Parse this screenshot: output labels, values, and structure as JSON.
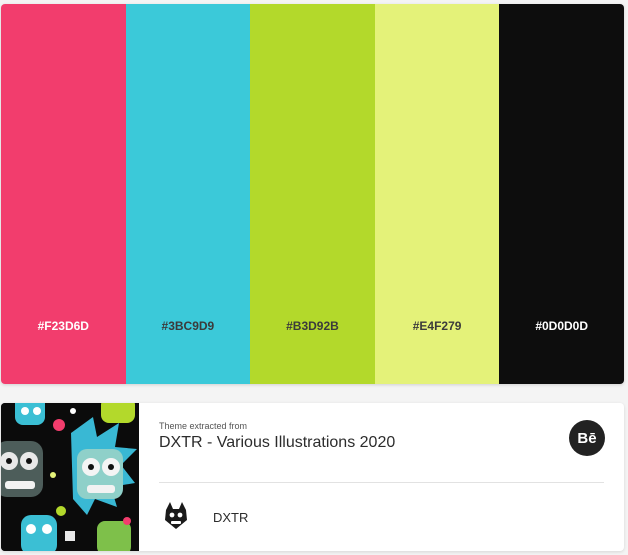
{
  "palette": {
    "swatches": [
      {
        "hex": "#F23D6D",
        "color": "#F23D6D",
        "text_tone": "light"
      },
      {
        "hex": "#3BC9D9",
        "color": "#3BC9D9",
        "text_tone": "dark"
      },
      {
        "hex": "#B3D92B",
        "color": "#B3D92B",
        "text_tone": "dark"
      },
      {
        "hex": "#E4F279",
        "color": "#E4F279",
        "text_tone": "dark"
      },
      {
        "hex": "#0D0D0D",
        "color": "#0D0D0D",
        "text_tone": "light"
      }
    ]
  },
  "source": {
    "extracted_label": "Theme extracted from",
    "project_title": "DXTR - Various Illustrations 2020",
    "platform_icon": "behance-icon",
    "platform_label": "Bē",
    "author_name": "DXTR",
    "author_avatar_icon": "cat-avatar-icon",
    "thumbnail_icon": "illustration-thumbnail"
  }
}
